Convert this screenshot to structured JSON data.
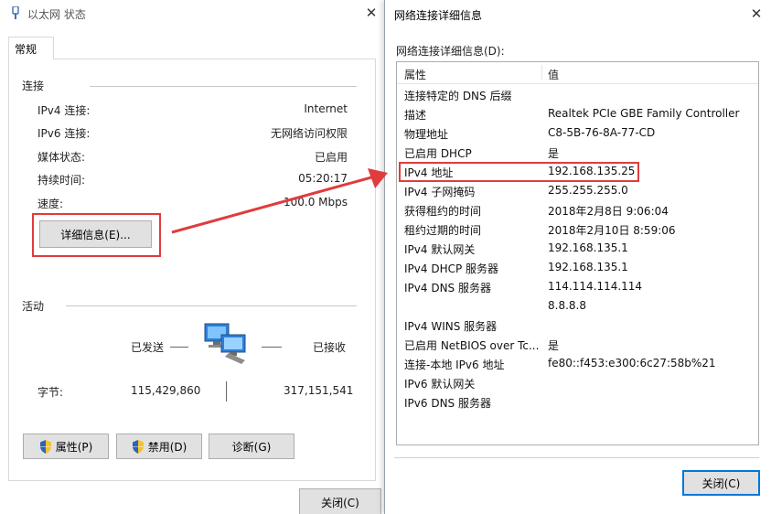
{
  "left_window": {
    "title": "以太网 状态",
    "tab": "常规",
    "connection": {
      "title": "连接",
      "rows": [
        {
          "label": "IPv4 连接:",
          "value": "Internet"
        },
        {
          "label": "IPv6 连接:",
          "value": "无网络访问权限"
        },
        {
          "label": "媒体状态:",
          "value": "已启用"
        },
        {
          "label": "持续时间:",
          "value": "05:20:17"
        },
        {
          "label": "速度:",
          "value": "100.0 Mbps"
        }
      ],
      "details_button": "详细信息(E)..."
    },
    "activity": {
      "title": "活动",
      "sent_label": "已发送",
      "received_label": "已接收",
      "bytes_label": "字节:",
      "bytes_sent": "115,429,860",
      "bytes_received": "317,151,541"
    },
    "buttons": {
      "properties": "属性(P)",
      "disable": "禁用(D)",
      "diagnose": "诊断(G)",
      "close": "关闭(C)"
    }
  },
  "right_window": {
    "title": "网络连接详细信息",
    "caption": "网络连接详细信息(D):",
    "columns": {
      "property": "属性",
      "value": "值"
    },
    "rows": [
      {
        "property": "连接特定的 DNS 后缀",
        "value": ""
      },
      {
        "property": "描述",
        "value": "Realtek PCIe GBE Family Controller"
      },
      {
        "property": "物理地址",
        "value": "C8-5B-76-8A-77-CD"
      },
      {
        "property": "已启用 DHCP",
        "value": "是"
      },
      {
        "property": "IPv4 地址",
        "value": "192.168.135.25"
      },
      {
        "property": "IPv4 子网掩码",
        "value": "255.255.255.0"
      },
      {
        "property": "获得租约的时间",
        "value": "2018年2月8日 9:06:04"
      },
      {
        "property": "租约过期的时间",
        "value": "2018年2月10日 8:59:06"
      },
      {
        "property": "IPv4 默认网关",
        "value": "192.168.135.1"
      },
      {
        "property": "IPv4 DHCP 服务器",
        "value": "192.168.135.1"
      },
      {
        "property": "IPv4 DNS 服务器",
        "value": "114.114.114.114"
      },
      {
        "property": "",
        "value": "8.8.8.8"
      },
      {
        "property": "IPv4 WINS 服务器",
        "value": ""
      },
      {
        "property": "已启用 NetBIOS over Tc...",
        "value": "是"
      },
      {
        "property": "连接-本地 IPv6 地址",
        "value": "fe80::f453:e300:6c27:58b%21"
      },
      {
        "property": "IPv6 默认网关",
        "value": ""
      },
      {
        "property": "IPv6 DNS 服务器",
        "value": ""
      }
    ],
    "close_button": "关闭(C)"
  },
  "colors": {
    "highlight": "#e03c3c",
    "button_face": "#e1e1e1",
    "default_button_border": "#0078d7"
  },
  "icons": {
    "window": "network-adapter-icon",
    "network": "network-computers-icon",
    "shield": "uac-shield-icon"
  }
}
